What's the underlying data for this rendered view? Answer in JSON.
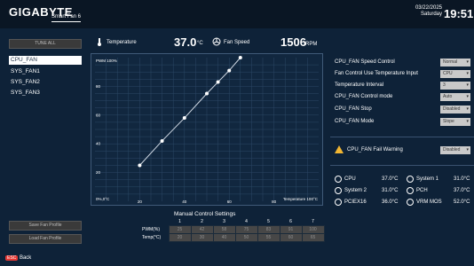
{
  "header": {
    "logo": "GIGABYTE",
    "tab": "Smart Fan 6",
    "date": "03/22/2025",
    "day": "Saturday",
    "time": "19:51"
  },
  "sidebar": {
    "tune_all": "TUNE ALL",
    "fans": [
      "CPU_FAN",
      "SYS_FAN1",
      "SYS_FAN2",
      "SYS_FAN3"
    ],
    "selected": "CPU_FAN",
    "save_profile": "Save Fan Profile",
    "load_profile": "Load Fan Profile"
  },
  "readout": {
    "temp_label": "Temperature",
    "temp_value": "37.0",
    "temp_unit": "°C",
    "speed_label": "Fan Speed",
    "speed_value": "1506",
    "speed_unit": "RPM"
  },
  "chart_data": {
    "type": "line",
    "ylabel": "PWM 100%",
    "xlabel": "Temperature 100°C",
    "origin_label": "0%,0°C",
    "x_ticks": [
      20,
      40,
      60,
      80
    ],
    "y_ticks": [
      20,
      40,
      60,
      80
    ],
    "xlim": [
      0,
      100
    ],
    "ylim": [
      0,
      100
    ],
    "grid": true,
    "points": [
      [
        20,
        25
      ],
      [
        30,
        42
      ],
      [
        40,
        58
      ],
      [
        50,
        75
      ],
      [
        55,
        83
      ],
      [
        60,
        91
      ],
      [
        65,
        100
      ]
    ]
  },
  "settings": [
    {
      "label": "CPU_FAN Speed Control",
      "value": "Normal"
    },
    {
      "label": "Fan Control Use Temperature Input",
      "value": "CPU"
    },
    {
      "label": "Temperature Interval",
      "value": "3"
    },
    {
      "label": "CPU_FAN Control mode",
      "value": "Auto"
    },
    {
      "label": "CPU_FAN Stop",
      "value": "Disabled"
    },
    {
      "label": "CPU_FAN Mode",
      "value": "Slope"
    }
  ],
  "warning": {
    "label": "CPU_FAN Fail Warning",
    "value": "Disabled"
  },
  "sensors": [
    {
      "name": "CPU",
      "value": "37.0°C"
    },
    {
      "name": "System 1",
      "value": "31.0°C"
    },
    {
      "name": "System 2",
      "value": "31.0°C"
    },
    {
      "name": "PCH",
      "value": "37.0°C"
    },
    {
      "name": "PCIEX16",
      "value": "36.0°C"
    },
    {
      "name": "VRM MOS",
      "value": "52.0°C"
    }
  ],
  "manual": {
    "title": "Manual Control Settings",
    "columns": [
      "1",
      "2",
      "3",
      "4",
      "5",
      "6",
      "7"
    ],
    "pwm_label": "PWM(%)",
    "temp_label": "Temp(°C)",
    "pwm": [
      "25",
      "42",
      "58",
      "75",
      "83",
      "91",
      "100"
    ],
    "temp": [
      "20",
      "30",
      "40",
      "50",
      "55",
      "60",
      "65"
    ]
  },
  "footer": {
    "key": "ESC",
    "label": "Back"
  },
  "colors": {
    "accent": "#f2b632",
    "line": "#cfd8e3",
    "point": "#ffffff"
  }
}
